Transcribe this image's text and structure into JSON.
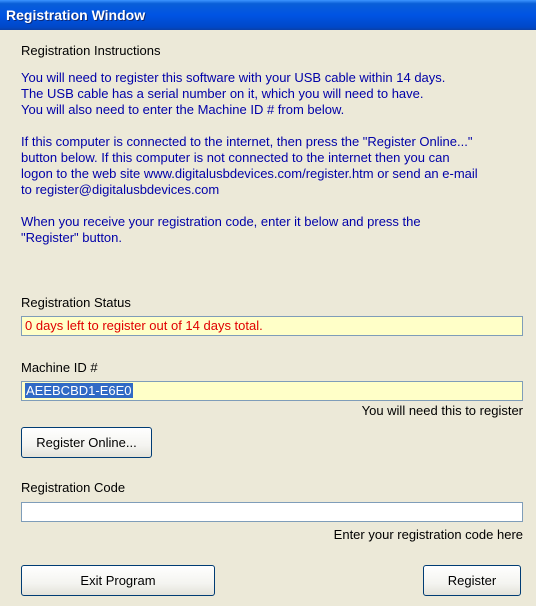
{
  "window": {
    "title": "Registration Window"
  },
  "instructions": {
    "heading": "Registration Instructions",
    "paragraphs": [
      "You will need to register this software with your USB cable within 14 days.\nThe USB cable has a serial number on it, which you will need to have.\nYou will also need to enter the Machine ID # from below.",
      "If this computer is connected to the internet, then press the \"Register Online...\"\nbutton below.  If this computer is not connected to the internet then you can\nlogon to the web site www.digitalusbdevices.com/register.htm or send an e-mail\nto register@digitalusbdevices.com",
      "When you receive your registration code, enter it below and press the\n\"Register\" button."
    ]
  },
  "status": {
    "label": "Registration Status",
    "value": "0 days left to register out of 14 days total.",
    "color": "#e00000"
  },
  "machine": {
    "label": "Machine ID #",
    "value": "AEEBCBD1-E6E0",
    "hint": "You will need this to register"
  },
  "buttons": {
    "register_online": "Register Online...",
    "exit": "Exit Program",
    "register": "Register"
  },
  "code": {
    "label": "Registration Code",
    "value": "",
    "hint": "Enter your registration code here"
  }
}
